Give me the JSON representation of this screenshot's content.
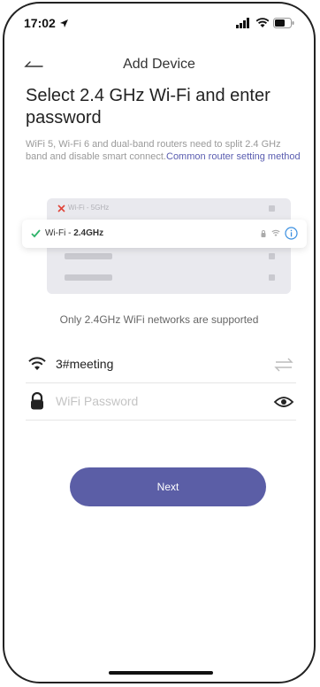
{
  "status_bar": {
    "time": "17:02",
    "icons": [
      "location-arrow-icon",
      "signal-icon",
      "wifi-icon",
      "battery-icon"
    ]
  },
  "nav": {
    "title": "Add Device",
    "back_icon": "back-arrow-icon"
  },
  "heading": "Select 2.4 GHz Wi-Fi and enter password",
  "description": {
    "text": "WiFi 5, Wi-Fi 6 and dual-band routers need to split 2.4 GHz band and disable smart connect.",
    "link": "Common router setting method"
  },
  "router_illustration": {
    "band_5g_label": "Wi-Fi - 5GHz",
    "band_24_prefix": "Wi-Fi - ",
    "band_24_value": "2.4GHz"
  },
  "supported_note": "Only 2.4GHz WiFi networks are supported",
  "wifi_field": {
    "ssid": "3#meeting",
    "icon": "wifi-icon",
    "switch_icon": "switch-network-icon"
  },
  "password_field": {
    "placeholder": "WiFi Password",
    "value": "",
    "icon": "lock-icon",
    "toggle_icon": "eye-icon"
  },
  "next_button": {
    "label": "Next"
  },
  "colors": {
    "accent": "#5b5ea6",
    "link": "#5a5db0",
    "check_green": "#2fb36a",
    "cross_red": "#e0453a",
    "info_blue": "#3a8fe0"
  }
}
